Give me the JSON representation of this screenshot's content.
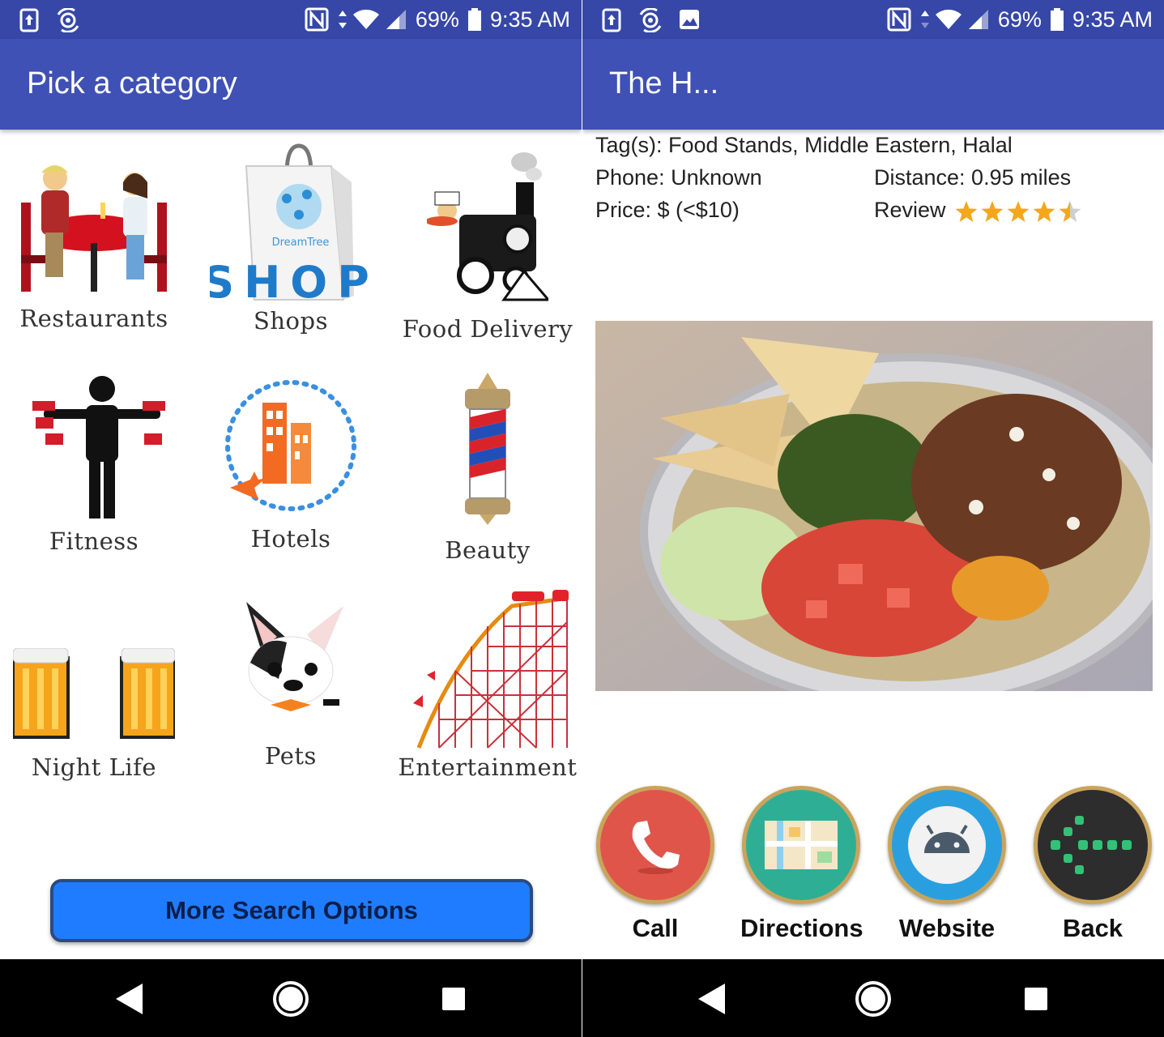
{
  "status_bar": {
    "battery": "69%",
    "time": "9:35 AM"
  },
  "left": {
    "title": "Pick a category",
    "categories": [
      {
        "label": "Restaurants",
        "icon": "restaurant-couple-icon"
      },
      {
        "label": "Shops",
        "icon": "shopping-bag-icon",
        "bag_text": "SHOP",
        "bag_brand": "DreamTree"
      },
      {
        "label": "Food Delivery",
        "icon": "train-delivery-icon"
      },
      {
        "label": "Fitness",
        "icon": "weightlifter-icon"
      },
      {
        "label": "Hotels",
        "icon": "hotel-building-icon"
      },
      {
        "label": "Beauty",
        "icon": "barber-pole-icon"
      },
      {
        "label": "Night Life",
        "icon": "beer-mugs-icon"
      },
      {
        "label": "Pets",
        "icon": "dog-icon"
      },
      {
        "label": "Entertainment",
        "icon": "roller-coaster-icon"
      }
    ],
    "more_button": "More Search Options"
  },
  "right": {
    "title": "The H...",
    "tags": "Tag(s): Food Stands, Middle Eastern, Halal",
    "phone": "Phone: Unknown",
    "distance": "Distance: 0.95 miles",
    "price": "Price: $ (<$10)",
    "review_label": "Review",
    "rating": 4.5,
    "rating_max": 5,
    "actions": [
      {
        "label": "Call",
        "icon": "phone-icon"
      },
      {
        "label": "Directions",
        "icon": "map-icon"
      },
      {
        "label": "Website",
        "icon": "android-icon"
      },
      {
        "label": "Back",
        "icon": "back-arrow-icon"
      }
    ]
  },
  "colors": {
    "app_bar": "#3f51b5",
    "status_bar": "#3647a8",
    "button": "#1f7cff",
    "star": "#f4a71b"
  }
}
